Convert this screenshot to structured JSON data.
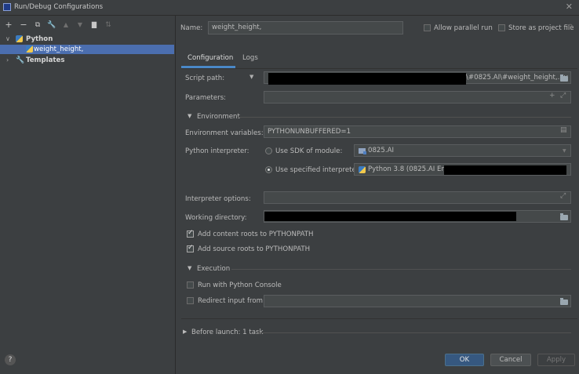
{
  "window": {
    "title": "Run/Debug Configurations",
    "close": "✕"
  },
  "toolbar": {
    "add": "+",
    "remove": "−",
    "copy": "⧉",
    "wrench": "🔧",
    "up": "▲",
    "down": "▼",
    "folder": "▇",
    "sort": "⇅"
  },
  "tree": {
    "python_group": "Python",
    "python_item": "weight_height,",
    "templates": "Templates"
  },
  "name": {
    "label": "Name:",
    "value": "weight_height,"
  },
  "options": {
    "allow_parallel": "Allow parallel run",
    "store_as_project": "Store as project file"
  },
  "tabs": {
    "configuration": "Configuration",
    "logs": "Logs"
  },
  "form": {
    "script_path_label": "Script path:",
    "script_path_value": "\\#0825.AI\\#weight_height,.py",
    "parameters_label": "Parameters:",
    "environment_section": "Environment",
    "env_vars_label": "Environment variables:",
    "env_vars_value": "PYTHONUNBUFFERED=1",
    "interpreter_label": "Python interpreter:",
    "use_sdk": "Use SDK of module:",
    "sdk_module": "0825.AI",
    "use_specified": "Use specified interpreter:",
    "interpreter_value": "Python 3.8 (0825.AI Env)",
    "interp_options_label": "Interpreter options:",
    "working_dir_label": "Working directory:",
    "add_content_roots": "Add content roots to PYTHONPATH",
    "add_source_roots": "Add source roots to PYTHONPATH",
    "execution_section": "Execution",
    "run_with_console": "Run with Python Console",
    "redirect_input": "Redirect input from:",
    "before_launch": "Before launch: 1 task"
  },
  "buttons": {
    "ok": "OK",
    "cancel": "Cancel",
    "apply": "Apply",
    "help": "?"
  }
}
